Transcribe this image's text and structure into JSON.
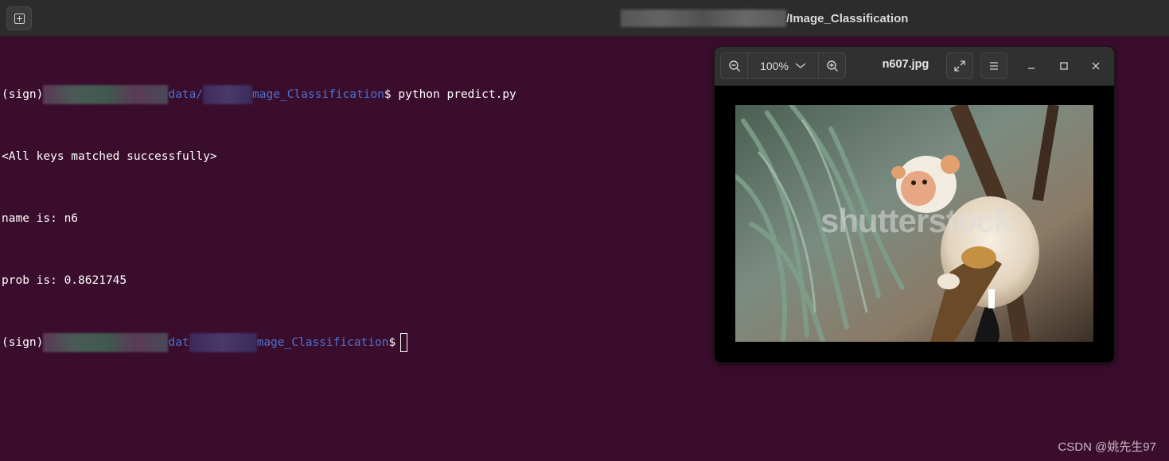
{
  "terminal": {
    "title": "/Image_Classification",
    "lines": {
      "l1_prefix": "(sign)",
      "l1_path_a": "data/",
      "l1_path_b": "mage_Classification",
      "l1_cmd": "$ python predict.py",
      "l2": "<All keys matched successfully>",
      "l3": "name is: n6",
      "l4": "prob is: 0.8621745",
      "l5_prefix": "(sign)",
      "l5_path_a": "dat",
      "l5_path_b": "mage_Classification",
      "l5_prompt": "$"
    }
  },
  "viewer": {
    "zoom_level": "100%",
    "filename": "n607.jpg",
    "watermark_text": "shutterstock",
    "icons": {
      "zoom_out": "zoom-out-icon",
      "zoom_in": "zoom-in-icon",
      "fullscreen": "fullscreen-icon",
      "menu": "hamburger-menu-icon",
      "minimize": "minimize-icon",
      "maximize": "maximize-icon",
      "close": "close-icon"
    }
  },
  "footer": {
    "credit": "CSDN @姚先生97"
  },
  "colors": {
    "terminal_bg": "#3b0d2c",
    "path_blue": "#4a74d6",
    "titlebar_bg": "#2c2c2c"
  }
}
